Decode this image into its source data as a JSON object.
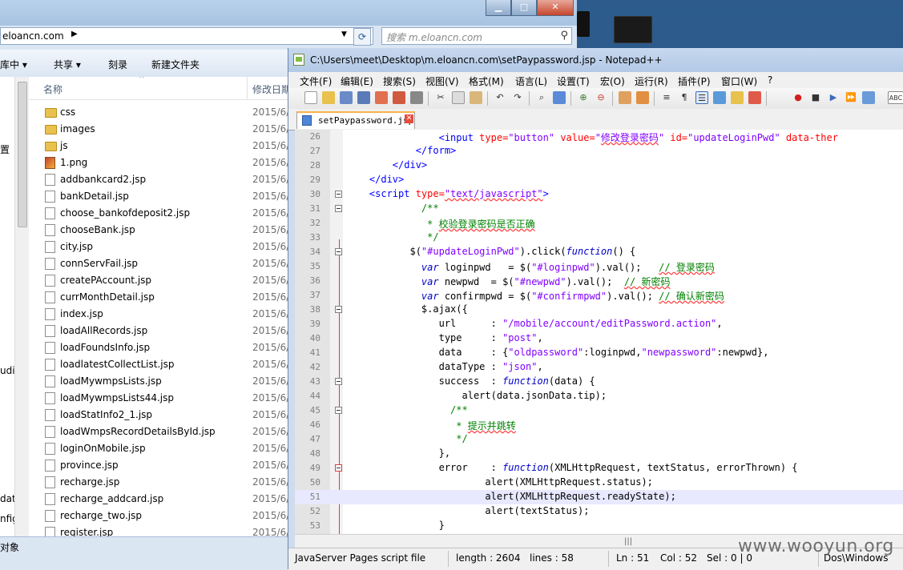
{
  "explorer": {
    "address": "eloancn.com",
    "search_placeholder": "搜索 m.eloancn.com",
    "toolbar": {
      "library": "库中 ▾",
      "share": "共享 ▾",
      "burn": "刻录",
      "new_folder": "新建文件夹"
    },
    "nav_fragments": [
      "置",
      "udi",
      "dat",
      "nfig"
    ],
    "columns": {
      "name": "名称",
      "date": "修改日期"
    },
    "files": [
      {
        "name": "css",
        "type": "folder",
        "date": "2015/6/"
      },
      {
        "name": "images",
        "type": "folder",
        "date": "2015/6/"
      },
      {
        "name": "js",
        "type": "folder",
        "date": "2015/6/"
      },
      {
        "name": "1.png",
        "type": "image",
        "date": "2015/6/"
      },
      {
        "name": "addbankcard2.jsp",
        "type": "file",
        "date": "2015/6/"
      },
      {
        "name": "bankDetail.jsp",
        "type": "file",
        "date": "2015/6/"
      },
      {
        "name": "choose_bankofdeposit2.jsp",
        "type": "file",
        "date": "2015/6/"
      },
      {
        "name": "chooseBank.jsp",
        "type": "file",
        "date": "2015/6/"
      },
      {
        "name": "city.jsp",
        "type": "file",
        "date": "2015/6/"
      },
      {
        "name": "connServFail.jsp",
        "type": "file",
        "date": "2015/6/"
      },
      {
        "name": "createPAccount.jsp",
        "type": "file",
        "date": "2015/6/"
      },
      {
        "name": "currMonthDetail.jsp",
        "type": "file",
        "date": "2015/6/"
      },
      {
        "name": "index.jsp",
        "type": "file",
        "date": "2015/6/"
      },
      {
        "name": "loadAllRecords.jsp",
        "type": "file",
        "date": "2015/6/"
      },
      {
        "name": "loadFoundsInfo.jsp",
        "type": "file",
        "date": "2015/6/"
      },
      {
        "name": "loadlatestCollectList.jsp",
        "type": "file",
        "date": "2015/6/"
      },
      {
        "name": "loadMywmpsLists.jsp",
        "type": "file",
        "date": "2015/6/"
      },
      {
        "name": "loadMywmpsLists44.jsp",
        "type": "file",
        "date": "2015/6/"
      },
      {
        "name": "loadStatInfo2_1.jsp",
        "type": "file",
        "date": "2015/6/"
      },
      {
        "name": "loadWmpsRecordDetailsById.jsp",
        "type": "file",
        "date": "2015/6/"
      },
      {
        "name": "loginOnMobile.jsp",
        "type": "file",
        "date": "2015/6/"
      },
      {
        "name": "province.jsp",
        "type": "file",
        "date": "2015/6/"
      },
      {
        "name": "recharge.jsp",
        "type": "file",
        "date": "2015/6/"
      },
      {
        "name": "recharge_addcard.jsp",
        "type": "file",
        "date": "2015/6/"
      },
      {
        "name": "recharge_two.jsp",
        "type": "file",
        "date": "2015/6/"
      },
      {
        "name": "register.jsp",
        "type": "file",
        "date": "2015/6/"
      }
    ],
    "status": "对象"
  },
  "npp": {
    "title": "C:\\Users\\meet\\Desktop\\m.eloancn.com\\setPaypassword.jsp - Notepad++",
    "menu": [
      "文件(F)",
      "编辑(E)",
      "搜索(S)",
      "视图(V)",
      "格式(M)",
      "语言(L)",
      "设置(T)",
      "宏(O)",
      "运行(R)",
      "插件(P)",
      "窗口(W)",
      "?"
    ],
    "tab": "setPaypassword.jsp",
    "current_line": 51,
    "lines": [
      {
        "n": 26,
        "segs": [
          [
            "                ",
            ""
          ],
          [
            "<input ",
            "kw"
          ],
          [
            "type=",
            "attr"
          ],
          [
            "\"button\"",
            "str"
          ],
          [
            " ",
            ""
          ],
          [
            "value=",
            "attr"
          ],
          [
            "\"",
            "str"
          ],
          [
            "修改登录密码",
            "cjk sq"
          ],
          [
            "\"",
            "str"
          ],
          [
            " ",
            ""
          ],
          [
            "id=",
            "attr"
          ],
          [
            "\"updateLoginPwd\"",
            "str"
          ],
          [
            " data-ther",
            "attr"
          ]
        ]
      },
      {
        "n": 27,
        "segs": [
          [
            "            ",
            ""
          ],
          [
            "</form>",
            "kw"
          ]
        ]
      },
      {
        "n": 28,
        "segs": [
          [
            "        ",
            ""
          ],
          [
            "</div>",
            "kw"
          ]
        ]
      },
      {
        "n": 29,
        "segs": [
          [
            "    ",
            ""
          ],
          [
            "</div>",
            "kw"
          ]
        ]
      },
      {
        "n": 30,
        "segs": [
          [
            "    ",
            ""
          ],
          [
            "<script ",
            "kw"
          ],
          [
            "type=",
            "attr"
          ],
          [
            "\"text/javascript\"",
            "str sq"
          ],
          [
            ">",
            "kw"
          ]
        ]
      },
      {
        "n": 31,
        "segs": [
          [
            "             ",
            ""
          ],
          [
            "/**",
            "cm"
          ]
        ]
      },
      {
        "n": 32,
        "segs": [
          [
            "              ",
            ""
          ],
          [
            "* ",
            "cm"
          ],
          [
            "校验登录密码是否正确",
            "cmz sq"
          ]
        ]
      },
      {
        "n": 33,
        "segs": [
          [
            "              ",
            ""
          ],
          [
            "*/",
            "cm"
          ]
        ]
      },
      {
        "n": 34,
        "segs": [
          [
            "           $(",
            ""
          ],
          [
            "\"#updateLoginPwd\"",
            "str"
          ],
          [
            ").click(",
            ""
          ],
          [
            "function",
            "jskw"
          ],
          [
            "() {",
            ""
          ]
        ]
      },
      {
        "n": 35,
        "segs": [
          [
            "             ",
            ""
          ],
          [
            "var",
            "jskw"
          ],
          [
            " loginpwd   = $(",
            ""
          ],
          [
            "\"#loginpwd\"",
            "str"
          ],
          [
            ").val();   ",
            ""
          ],
          [
            "// 登录密码",
            "cm sq"
          ]
        ]
      },
      {
        "n": 36,
        "segs": [
          [
            "             ",
            ""
          ],
          [
            "var",
            "jskw"
          ],
          [
            " newpwd  = $(",
            ""
          ],
          [
            "\"#newpwd\"",
            "str"
          ],
          [
            ").val();  ",
            ""
          ],
          [
            "// 新密码",
            "cm sq"
          ]
        ]
      },
      {
        "n": 37,
        "segs": [
          [
            "             ",
            ""
          ],
          [
            "var",
            "jskw"
          ],
          [
            " confirmpwd = $(",
            ""
          ],
          [
            "\"#confirmpwd\"",
            "str"
          ],
          [
            ").val(); ",
            ""
          ],
          [
            "// 确认新密码",
            "cm sq"
          ]
        ]
      },
      {
        "n": 38,
        "segs": [
          [
            "             $.ajax({",
            ""
          ]
        ]
      },
      {
        "n": 39,
        "segs": [
          [
            "                url      : ",
            ""
          ],
          [
            "\"/mobile/account/editPassword.action\"",
            "str"
          ],
          [
            ",",
            ""
          ]
        ]
      },
      {
        "n": 40,
        "segs": [
          [
            "                type     : ",
            ""
          ],
          [
            "\"post\"",
            "str"
          ],
          [
            ",",
            ""
          ]
        ]
      },
      {
        "n": 41,
        "segs": [
          [
            "                data     : {",
            ""
          ],
          [
            "\"oldpassword\"",
            "str"
          ],
          [
            ":loginpwd,",
            ""
          ],
          [
            "\"newpassword\"",
            "str"
          ],
          [
            ":newpwd},",
            ""
          ]
        ]
      },
      {
        "n": 42,
        "segs": [
          [
            "                dataType : ",
            ""
          ],
          [
            "\"json\"",
            "str"
          ],
          [
            ",",
            ""
          ]
        ]
      },
      {
        "n": 43,
        "segs": [
          [
            "                success  : ",
            ""
          ],
          [
            "function",
            "jskw"
          ],
          [
            "(data) {",
            ""
          ]
        ]
      },
      {
        "n": 44,
        "segs": [
          [
            "                    alert(data.jsonData.tip);",
            ""
          ]
        ]
      },
      {
        "n": 45,
        "segs": [
          [
            "                  ",
            ""
          ],
          [
            "/**",
            "cm"
          ]
        ]
      },
      {
        "n": 46,
        "segs": [
          [
            "                   ",
            ""
          ],
          [
            "* ",
            "cm"
          ],
          [
            "提示并跳转",
            "cmz sq"
          ]
        ]
      },
      {
        "n": 47,
        "segs": [
          [
            "                   ",
            ""
          ],
          [
            "*/",
            "cm"
          ]
        ]
      },
      {
        "n": 48,
        "segs": [
          [
            "                },",
            ""
          ]
        ]
      },
      {
        "n": 49,
        "segs": [
          [
            "                error    : ",
            ""
          ],
          [
            "function",
            "jskw"
          ],
          [
            "(XMLHttpRequest, textStatus, errorThrown) {",
            ""
          ]
        ]
      },
      {
        "n": 50,
        "segs": [
          [
            "                        alert(XMLHttpRequest.status);",
            ""
          ]
        ]
      },
      {
        "n": 51,
        "segs": [
          [
            "                        alert(XMLHttpRequest.readyState);",
            ""
          ]
        ]
      },
      {
        "n": 52,
        "segs": [
          [
            "                        alert(textStatus);",
            ""
          ]
        ]
      },
      {
        "n": 53,
        "segs": [
          [
            "                }",
            ""
          ]
        ]
      }
    ],
    "status": {
      "type": "JavaServer Pages script file",
      "length": "length : 2604",
      "lines": "lines : 58",
      "ln": "Ln : 51",
      "col": "Col : 52",
      "sel": "Sel : 0 | 0",
      "eol": "Dos\\Windows"
    }
  },
  "watermark": "www.wooyun.org"
}
